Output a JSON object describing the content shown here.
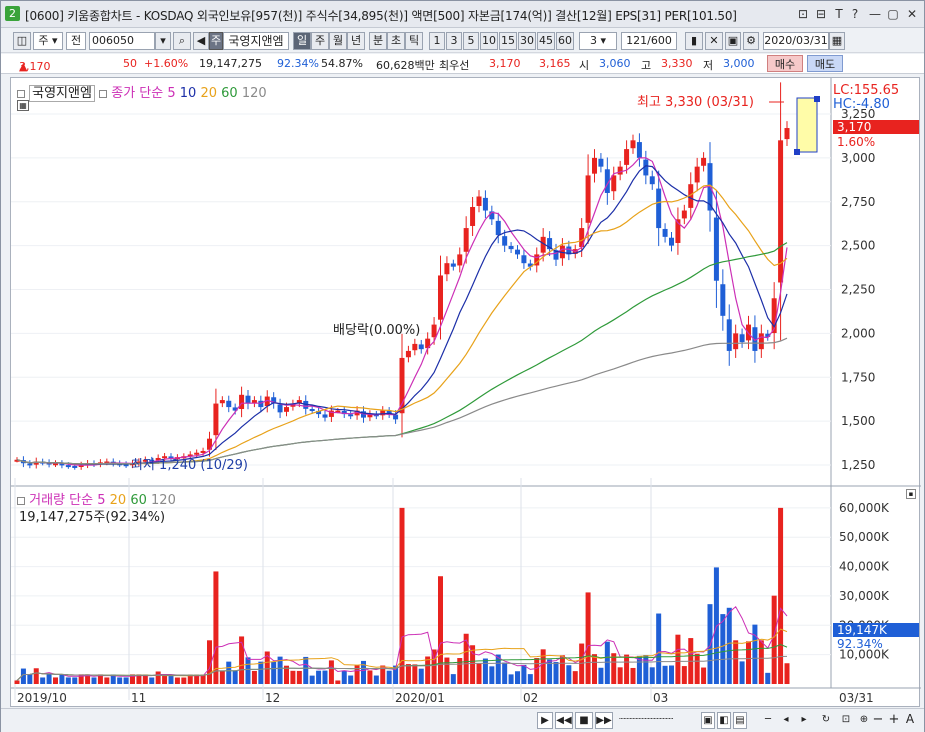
{
  "title": {
    "icon": "2",
    "text": "[0600] 키움종합차트 - KOSDAQ 외국인보유[957(천)] 주식수[34,895(천)] 액면[500] 자본금[174(억)] 결산[12월] EPS[31] PER[101.50]",
    "buttons": [
      "⊡",
      "⊟",
      "T",
      "?",
      "—",
      "▢",
      "✕"
    ]
  },
  "toolbar": {
    "period_label": "주",
    "all_label": "전",
    "code": "006050",
    "stock_name": "국영지앤엠",
    "stock_prefix": "주",
    "period_tabs": [
      "일",
      "주",
      "월",
      "년",
      "분",
      "초",
      "틱"
    ],
    "active_period": "일",
    "intervals": [
      "1",
      "3",
      "5",
      "10",
      "15",
      "30",
      "45",
      "60"
    ],
    "interval_value": "3",
    "count": "121",
    "count_total": "/600",
    "date": "2020/03/31"
  },
  "info": {
    "price": "3,170",
    "arrow": "▲",
    "change": "50",
    "change_pct": "+1.60%",
    "volume": "19,147,275",
    "vol_ratio": "92.34%",
    "rate2": "54.87%",
    "amount": "60,628백만",
    "pref_label": "최우선",
    "pref_ask": "3,170",
    "pref_bid": "3,165",
    "open_label": "시",
    "open": "3,060",
    "high_label": "고",
    "high": "3,330",
    "low_label": "저",
    "low": "3,000",
    "buy": "매수",
    "sell": "매도"
  },
  "price_panel": {
    "stock_name": "국영지앤엠",
    "ma_label": "종가 단순",
    "ma_periods": [
      "5",
      "10",
      "20",
      "60",
      "120"
    ],
    "ma_colors": [
      "#cc2fb6",
      "#1c2fa8",
      "#e8a21a",
      "#2f9a3a",
      "#8a8a8a"
    ],
    "y_ticks": [
      "3,250",
      "3,000",
      "2,750",
      "2,500",
      "2,250",
      "2,000",
      "1,750",
      "1,500",
      "1,250"
    ],
    "lc_label": "LC:155.65",
    "hc_label": "HC:-4.80",
    "current_tag": "3,170",
    "current_pct": "1.60%",
    "high_note": "최고 3,330 (03/31)",
    "low_note": "최저 1,240 (10/29)",
    "dividend_note": "배당락(0.00%)"
  },
  "volume_panel": {
    "label": "거래량",
    "ma_label": "단순",
    "ma_periods": [
      "5",
      "20",
      "60",
      "120"
    ],
    "ma_colors": [
      "#cc2fb6",
      "#e8a21a",
      "#2f9a3a",
      "#8a8a8a"
    ],
    "current_text": "19,147,275주(92.34%)",
    "y_ticks": [
      "60,000K",
      "50,000K",
      "40,000K",
      "30,000K",
      "20,000K",
      "10,000K"
    ],
    "current_tag": "19,147K",
    "current_pct": "92.34%"
  },
  "x_axis": {
    "labels": [
      "2019/10",
      "11",
      "12",
      "2020/01",
      "02",
      "03"
    ],
    "right_label": "03/31"
  },
  "colors": {
    "up": "#e8231f",
    "down": "#1f5fd6"
  },
  "chart_data": {
    "type": "candlestick",
    "y_range": [
      1250,
      3330
    ],
    "segments": [
      {
        "n": 30,
        "close": [
          1280,
          1260,
          1250,
          1270,
          1265,
          1255,
          1260,
          1250,
          1245,
          1240,
          1250,
          1260,
          1255,
          1265,
          1270,
          1260,
          1255,
          1250,
          1260,
          1270,
          1280,
          1275,
          1290,
          1300,
          1290,
          1295,
          1300,
          1310,
          1320,
          1330
        ]
      },
      {
        "n": 20,
        "close": [
          1400,
          1600,
          1620,
          1580,
          1560,
          1650,
          1600,
          1620,
          1580,
          1640,
          1600,
          1550,
          1580,
          1600,
          1620,
          1570,
          1560,
          1540,
          1520,
          1560
        ]
      },
      {
        "n": 10,
        "close": [
          1560,
          1540,
          1530,
          1560,
          1520,
          1540,
          1530,
          1560,
          1540,
          1510
        ]
      },
      {
        "n": 20,
        "close": [
          1860,
          1900,
          1940,
          1910,
          1970,
          2050,
          2330,
          2400,
          2380,
          2450,
          2600,
          2720,
          2780,
          2700,
          2650,
          2560,
          2500,
          2480,
          2450,
          2400
        ]
      },
      {
        "n": 25,
        "close": [
          2380,
          2450,
          2550,
          2480,
          2420,
          2500,
          2450,
          2480,
          2600,
          2900,
          3000,
          2950,
          2800,
          2900,
          2950,
          3050,
          3100,
          3000,
          2900,
          2850,
          2600,
          2550,
          2500,
          2650,
          2700
        ]
      },
      {
        "n": 16,
        "close": [
          2850,
          2950,
          3000,
          2700,
          2300,
          2100,
          1900,
          2000,
          1950,
          2050,
          1900,
          2000,
          1980,
          2200,
          3100,
          3170
        ]
      }
    ]
  }
}
